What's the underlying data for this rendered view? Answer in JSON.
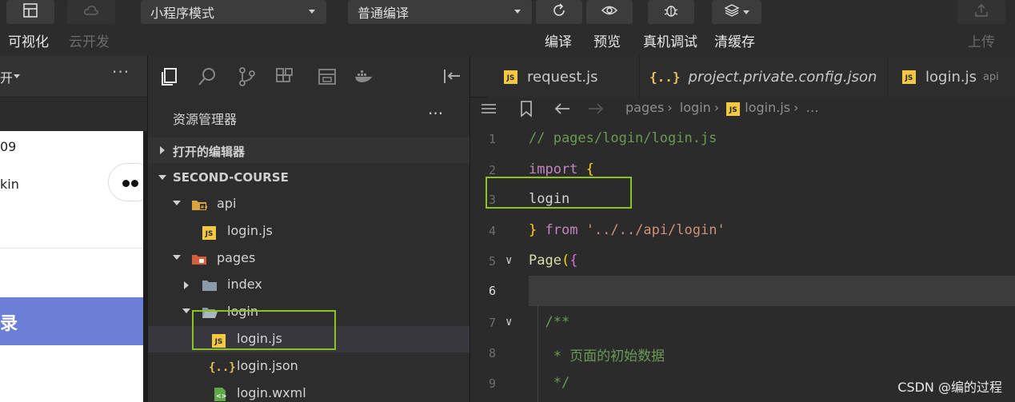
{
  "toolbar": {
    "left_labels": [
      "可视化",
      "云开发"
    ],
    "mode_select": "小程序模式",
    "compile_select": "普通编译",
    "actions": [
      "编译",
      "预览",
      "真机调试",
      "清缓存"
    ],
    "upload": "上传"
  },
  "simulator": {
    "header_text": "开",
    "more": "···",
    "line1": "09",
    "line2": "kin",
    "button_text": "录"
  },
  "explorer": {
    "title": "资源管理器",
    "more": "···",
    "open_editors": "打开的编辑器",
    "project": "SECOND-COURSE",
    "tree": [
      {
        "label": "api"
      },
      {
        "label": "login.js"
      },
      {
        "label": "pages"
      },
      {
        "label": "index"
      },
      {
        "label": "login"
      },
      {
        "label": "login.js"
      },
      {
        "label": "login.json"
      },
      {
        "label": "login.wxml"
      }
    ]
  },
  "editor": {
    "tabs": [
      {
        "label": "request.js"
      },
      {
        "label": "project.private.config.json"
      },
      {
        "label": "login.js",
        "sub": "api"
      }
    ],
    "breadcrumb": [
      "pages",
      "login",
      "login.js",
      "…"
    ],
    "lines": [
      {
        "n": "1",
        "parts": [
          [
            "c-comment",
            "// pages/login/login.js"
          ]
        ]
      },
      {
        "n": "2",
        "parts": [
          [
            "c-kw2",
            "import"
          ],
          [
            "c-txt",
            " "
          ],
          [
            "c-brace",
            "{"
          ]
        ]
      },
      {
        "n": "3",
        "parts": [
          [
            "c-txt",
            "login"
          ]
        ]
      },
      {
        "n": "4",
        "parts": [
          [
            "c-brace",
            "}"
          ],
          [
            "c-txt",
            " "
          ],
          [
            "c-kw2",
            "from"
          ],
          [
            "c-txt",
            " "
          ],
          [
            "c-str",
            "'../../api/login'"
          ]
        ]
      },
      {
        "n": "5",
        "parts": [
          [
            "c-fn",
            "Page"
          ],
          [
            "c-brace",
            "("
          ],
          [
            "c-brace2",
            "{"
          ]
        ]
      },
      {
        "n": "6",
        "parts": []
      },
      {
        "n": "7",
        "parts": [
          [
            "c-comment",
            "  /**"
          ]
        ]
      },
      {
        "n": "8",
        "parts": [
          [
            "c-comment",
            "   * 页面的初始数据"
          ]
        ]
      },
      {
        "n": "9",
        "parts": [
          [
            "c-comment",
            "   */"
          ]
        ]
      }
    ]
  },
  "watermark": "CSDN @编的过程",
  "colors": {
    "accent_highlight": "#8cc320",
    "js_badge": "#f5c842",
    "sim_button": "#6b7fd7"
  }
}
